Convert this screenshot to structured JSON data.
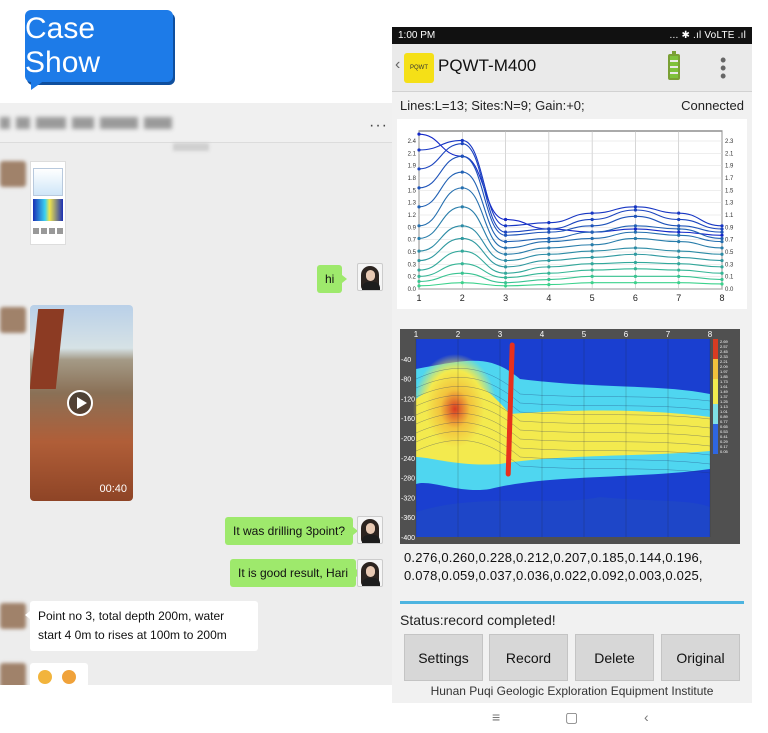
{
  "banner": {
    "label": "Case Show"
  },
  "chat": {
    "more": "···",
    "messages": {
      "hi": "hi",
      "drilling": "It was drilling 3point?",
      "good": "It is good result, Hari",
      "reply": "Point no 3, total depth 200m, water start 4 0m to rises at 100m to 200m"
    },
    "video_duration": "00:40"
  },
  "phone": {
    "status_time": "1:00 PM",
    "status_right": "... ✱ .ıl VoLTE .ıl",
    "logo_text": "PQWT",
    "app_title": "PQWT-M400",
    "info_line": "Lines:L=13;  Sites:N=9;  Gain:+0;",
    "connection": "Connected",
    "data_line1": "0.276,0.260,0.228,0.212,0.207,0.185,0.144,0.196,",
    "data_line2": "0.078,0.059,0.037,0.036,0.022,0.092,0.003,0.025,",
    "status": "Status:record completed!",
    "buttons": {
      "settings": "Settings",
      "record": "Record",
      "delete": "Delete",
      "original": "Original"
    },
    "footer": "Hunan Puqi Geologic Exploration Equipment Institute",
    "nav": {
      "menu": "≡",
      "home": "▢",
      "back": "‹"
    }
  },
  "chart_data": [
    {
      "type": "line",
      "x": [
        1,
        2,
        3,
        4,
        5,
        6,
        7,
        8
      ],
      "ylim": [
        0,
        2.5
      ],
      "ytick_labels": [
        "0.0",
        "0.1",
        "0.3",
        "0.5",
        "0.7",
        "0.9",
        "1.1",
        "1.3",
        "1.5",
        "1.7",
        "1.9",
        "2.1",
        "2.3"
      ],
      "y_ticks_left": [
        "0.0",
        "0.2",
        "0.3",
        "0.5",
        "0.7",
        "0.9",
        "1.2",
        "1.3",
        "1.5",
        "1.8",
        "1.9",
        "2.1",
        "2.4"
      ],
      "x_ticks": [
        "1",
        "2",
        "3",
        "4",
        "5",
        "6",
        "7",
        "8"
      ],
      "series": [
        {
          "values": [
            2.45,
            2.1,
            1.1,
            0.95,
            0.9,
            0.95,
            0.9,
            0.85
          ]
        },
        {
          "values": [
            2.2,
            2.35,
            1.0,
            1.05,
            1.2,
            1.3,
            1.2,
            1.0
          ]
        },
        {
          "values": [
            1.9,
            2.3,
            0.9,
            0.95,
            1.1,
            1.25,
            1.1,
            0.95
          ]
        },
        {
          "values": [
            1.6,
            2.1,
            0.85,
            0.9,
            1.0,
            1.15,
            1.0,
            0.9
          ]
        },
        {
          "values": [
            1.3,
            1.85,
            0.75,
            0.8,
            0.9,
            1.0,
            0.95,
            0.8
          ]
        },
        {
          "values": [
            1.0,
            1.6,
            0.65,
            0.75,
            0.8,
            0.9,
            0.85,
            0.75
          ]
        },
        {
          "values": [
            0.8,
            1.3,
            0.55,
            0.65,
            0.7,
            0.8,
            0.75,
            0.65
          ]
        },
        {
          "values": [
            0.6,
            1.0,
            0.45,
            0.55,
            0.6,
            0.65,
            0.6,
            0.55
          ]
        },
        {
          "values": [
            0.45,
            0.8,
            0.35,
            0.45,
            0.5,
            0.55,
            0.5,
            0.45
          ]
        },
        {
          "values": [
            0.3,
            0.6,
            0.25,
            0.35,
            0.4,
            0.42,
            0.4,
            0.35
          ]
        },
        {
          "values": [
            0.2,
            0.4,
            0.18,
            0.25,
            0.3,
            0.32,
            0.3,
            0.25
          ]
        },
        {
          "values": [
            0.12,
            0.25,
            0.1,
            0.15,
            0.2,
            0.2,
            0.2,
            0.15
          ]
        },
        {
          "values": [
            0.05,
            0.1,
            0.05,
            0.07,
            0.1,
            0.1,
            0.1,
            0.08
          ]
        }
      ]
    },
    {
      "type": "heatmap",
      "x_ticks": [
        "1",
        "2",
        "3",
        "4",
        "5",
        "6",
        "7",
        "8"
      ],
      "y_ticks": [
        "-40",
        "-80",
        "-120",
        "-160",
        "-200",
        "-240",
        "-280",
        "-320",
        "-360",
        "-400"
      ],
      "legend_values": [
        "2.69",
        "2.57",
        "2.45",
        "2.33",
        "2.21",
        "2.09",
        "1.97",
        "1.85",
        "1.73",
        "1.61",
        "1.49",
        "1.37",
        "1.25",
        "1.13",
        "1.01",
        "0.89",
        "0.77",
        "0.65",
        "0.53",
        "0.41",
        "0.29",
        "0.17",
        "0.05"
      ],
      "marker_x": 2.1,
      "colors": {
        "low": "#1a3fd0",
        "mid": "#4fd6f0",
        "high": "#f3ea4e",
        "peak": "#d83c22"
      }
    }
  ]
}
